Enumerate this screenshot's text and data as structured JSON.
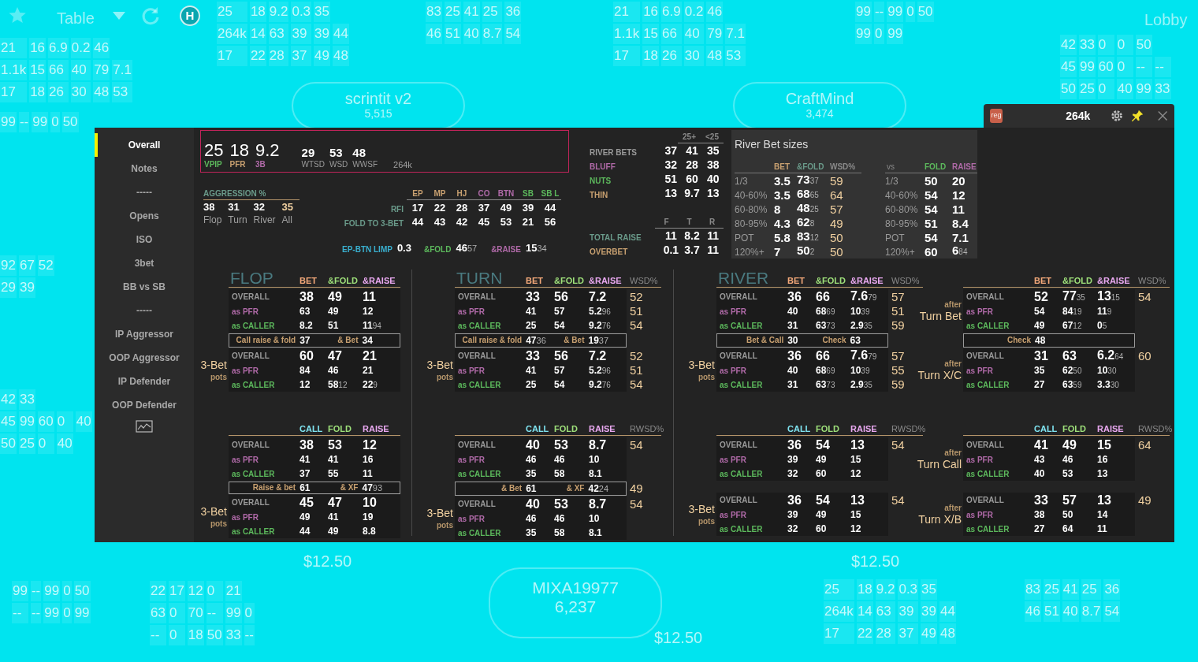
{
  "table": {
    "title": "Table",
    "hotkey": "H",
    "lobby": "Lobby",
    "players": [
      {
        "name": "scrintit v2",
        "stack": "5,515"
      },
      {
        "name": "CraftMind",
        "stack": "3,474"
      },
      {
        "name": "MIXA19977",
        "stack": "6,237"
      }
    ],
    "bets": [
      "$12.50",
      "$12.50",
      "$12.50"
    ],
    "huds": [
      {
        "rows": [
          [
            "21",
            "16",
            "6.9",
            "0.2",
            "46"
          ],
          [
            "1.1k",
            "15",
            "66",
            "40",
            "79",
            "7.1"
          ],
          [
            "17",
            "18",
            "26",
            "30",
            "48",
            "53"
          ]
        ]
      },
      {
        "rows": [
          [
            "25",
            "18",
            "9.2",
            "0.3",
            "35"
          ],
          [
            "264k",
            "14",
            "63",
            "39",
            "39",
            "44"
          ],
          [
            "17",
            "22",
            "28",
            "37",
            "49",
            "48"
          ]
        ]
      },
      {
        "rows": [
          [
            "83",
            "25",
            "41",
            "25",
            "36"
          ],
          [
            "46",
            "51",
            "40",
            "8.7",
            "54"
          ]
        ]
      },
      {
        "rows": [
          [
            "21",
            "16",
            "6.9",
            "0.2",
            "46"
          ],
          [
            "1.1k",
            "15",
            "66",
            "40",
            "79",
            "7.1"
          ],
          [
            "17",
            "18",
            "26",
            "30",
            "48",
            "53"
          ]
        ]
      },
      {
        "rows": [
          [
            "99",
            "--",
            "99",
            "0",
            "50"
          ],
          [
            "99",
            "0",
            "99"
          ]
        ]
      },
      {
        "rows": [
          [
            "42",
            "33",
            "0",
            "0",
            "50"
          ],
          [
            "45",
            "99",
            "60",
            "0",
            "--",
            "--"
          ],
          [
            "50",
            "25",
            "0",
            "40",
            "99",
            "33"
          ]
        ]
      },
      {
        "rows": [
          [
            "99",
            "--",
            "99",
            "0",
            "50"
          ]
        ]
      },
      {
        "rows": [
          [
            "92",
            "67",
            "52"
          ],
          [
            "29",
            "39"
          ]
        ]
      },
      {
        "rows": [
          [
            "42",
            "33"
          ],
          [
            "45",
            "99",
            "60",
            "0",
            "40"
          ],
          [
            "50",
            "25",
            "0",
            "40"
          ]
        ]
      },
      {
        "rows": [
          [
            "99",
            "--",
            "99",
            "0",
            "50"
          ],
          [
            "--",
            "--",
            "99",
            "0",
            "99"
          ]
        ]
      },
      {
        "rows": [
          [
            "22",
            "17",
            "12",
            "0",
            "21"
          ],
          [
            "63",
            "0",
            "70",
            "--",
            "99",
            "0"
          ],
          [
            "--",
            "0",
            "18",
            "50",
            "33",
            "--"
          ]
        ]
      },
      {
        "rows": [
          [
            "25",
            "18",
            "9.2",
            "0.3",
            "35"
          ],
          [
            "264k",
            "14",
            "63",
            "39",
            "39",
            "44"
          ],
          [
            "17",
            "22",
            "28",
            "37",
            "49",
            "48"
          ]
        ]
      },
      {
        "rows": [
          [
            "83",
            "25",
            "41",
            "25",
            "36"
          ],
          [
            "46",
            "51",
            "40",
            "8.7",
            "54"
          ]
        ]
      }
    ]
  },
  "window": {
    "badge": "reg",
    "hands": "264k"
  },
  "sidebar": [
    {
      "label": "Overall",
      "selected": true
    },
    {
      "label": "Notes",
      "selected": false
    },
    {
      "label": "-----",
      "selected": false
    },
    {
      "label": "Opens",
      "selected": false
    },
    {
      "label": "ISO",
      "selected": false
    },
    {
      "label": "3bet",
      "selected": false
    },
    {
      "label": "BB vs SB",
      "selected": false
    },
    {
      "label": "-----",
      "selected": false
    },
    {
      "label": "IP Aggressor",
      "selected": false
    },
    {
      "label": "OOP Aggressor",
      "selected": false
    },
    {
      "label": "IP Defender",
      "selected": false
    },
    {
      "label": "OOP Defender",
      "selected": false
    }
  ],
  "summary": {
    "main": [
      {
        "value": "25",
        "label": "VPIP",
        "color": "#5cb85c"
      },
      {
        "value": "18",
        "label": "PFR",
        "color": "#c8a070"
      },
      {
        "value": "9.2",
        "label": "3B",
        "color": "#b06aa8"
      }
    ],
    "secondary": [
      {
        "value": "29",
        "label": "WTSD"
      },
      {
        "value": "53",
        "label": "WSD"
      },
      {
        "value": "48",
        "label": "WWSF"
      }
    ],
    "hands": "264k"
  },
  "aggression": {
    "title": "AGGRESSION %",
    "items": [
      {
        "value": "38",
        "label": "Flop",
        "kind": "street"
      },
      {
        "value": "31",
        "label": "Turn",
        "kind": "street"
      },
      {
        "value": "32",
        "label": "River",
        "kind": "street"
      },
      {
        "value": "35",
        "label": "All",
        "kind": "total"
      }
    ]
  },
  "positions": {
    "columns": [
      {
        "label": "EP",
        "color": "#c8a070"
      },
      {
        "label": "MP",
        "color": "#c8a070"
      },
      {
        "label": "HJ",
        "color": "#c8a070"
      },
      {
        "label": "CO",
        "color": "#b06aa8"
      },
      {
        "label": "BTN",
        "color": "#b06aa8"
      },
      {
        "label": "SB",
        "color": "#5cb85c"
      },
      {
        "label": "SB L",
        "color": "#5cb85c"
      }
    ],
    "rows": [
      {
        "label": "RFI",
        "values": [
          "17",
          "22",
          "28",
          "37",
          "49",
          "39",
          "44"
        ]
      },
      {
        "label": "FOLD TO 3-BET",
        "values": [
          "44",
          "43",
          "42",
          "45",
          "53",
          "21",
          "56"
        ]
      }
    ]
  },
  "limp": {
    "label": "EP-BTN LIMP",
    "value": "0.3",
    "fold_label": "&FOLD",
    "fold": {
      "v": "46",
      "s": "57"
    },
    "raise_label": "&RAISE",
    "raise": {
      "v": "15",
      "s": "34"
    }
  },
  "river_bets": {
    "columns": [
      "25+",
      "<25"
    ],
    "rows": [
      {
        "label": "RIVER BETS",
        "color": "#9a9a9a",
        "values": [
          "37",
          "41",
          "35"
        ]
      },
      {
        "label": "BLUFF",
        "color": "#b06aa8",
        "values": [
          "32",
          "28",
          "38"
        ]
      },
      {
        "label": "NUTS",
        "color": "#5cb85c",
        "values": [
          "51",
          "60",
          "40"
        ]
      },
      {
        "label": "THIN",
        "color": "#c8a070",
        "values": [
          "13",
          "9.7",
          "13"
        ]
      }
    ]
  },
  "raises": {
    "columns": [
      "F",
      "T",
      "R"
    ],
    "rows": [
      {
        "label": "TOTAL RAISE",
        "color": "#6a9a8a",
        "values": [
          "11",
          "8.2",
          "11"
        ]
      },
      {
        "label": "OVERBET",
        "color": "#c8a070",
        "values": [
          "0.1",
          "3.7",
          "11"
        ]
      }
    ]
  },
  "river_bet_sizes": {
    "title": "River Bet sizes",
    "left": {
      "columns": [
        {
          "label": "BET",
          "color": "#c8a070"
        },
        {
          "label": "&FOLD",
          "color": "#6a9a8a"
        },
        {
          "label": "WSD%",
          "color": "#8a8a8a"
        }
      ],
      "rows": [
        {
          "label": "1/3",
          "values": [
            "3.5",
            {
              "v": "73",
              "s": "37"
            },
            "59"
          ]
        },
        {
          "label": "40-60%",
          "values": [
            "3.5",
            {
              "v": "68",
              "s": "65"
            },
            "64"
          ]
        },
        {
          "label": "60-80%",
          "values": [
            "8",
            {
              "v": "48",
              "s": "25"
            },
            "57"
          ]
        },
        {
          "label": "80-95%",
          "values": [
            "4.3",
            {
              "v": "62",
              "s": "8"
            },
            "49"
          ]
        },
        {
          "label": "POT",
          "values": [
            "5.8",
            {
              "v": "83",
              "s": "12"
            },
            "50"
          ]
        },
        {
          "label": "120%+",
          "values": [
            "7",
            {
              "v": "50",
              "s": "2"
            },
            "50"
          ]
        }
      ]
    },
    "right": {
      "corner": "vs",
      "columns": [
        {
          "label": "FOLD",
          "color": "#5cb85c"
        },
        {
          "label": "RAISE",
          "color": "#b06aa8"
        }
      ],
      "rows": [
        {
          "label": "1/3",
          "values": [
            "50",
            "20"
          ]
        },
        {
          "label": "40-60%",
          "values": [
            "54",
            "12"
          ]
        },
        {
          "label": "60-80%",
          "values": [
            "54",
            "11"
          ]
        },
        {
          "label": "80-95%",
          "values": [
            "51",
            "8.4"
          ]
        },
        {
          "label": "POT",
          "values": [
            "54",
            "7.1"
          ]
        },
        {
          "label": "120%+",
          "values": [
            "60",
            {
              "v": "6",
              "s": "84"
            }
          ]
        }
      ]
    }
  },
  "streets": [
    {
      "title": "FLOP",
      "blocks": [
        {
          "columns": [
            {
              "label": "BET",
              "color": "#f4a97a"
            },
            {
              "label": "&FOLD",
              "color": "#9ee07a"
            },
            {
              "label": "&RAISE",
              "color": "#e9a8f0"
            }
          ],
          "groups": [
            {
              "rows": [
                {
                  "label": "OVERALL",
                  "kind": "overall",
                  "values": [
                    "38",
                    "49",
                    "11"
                  ]
                },
                {
                  "label": "as PFR",
                  "kind": "pfr",
                  "values": [
                    "63",
                    "49",
                    "12"
                  ]
                },
                {
                  "label": "as CALLER",
                  "kind": "caller",
                  "values": [
                    "8.2",
                    "51",
                    {
                      "v": "11",
                      "s": "94"
                    }
                  ]
                }
              ]
            },
            {
              "label": [
                {
                  "text": "3-Bet",
                  "kind": "big"
                },
                {
                  "text": "pots",
                  "kind": "small"
                }
              ],
              "rows": [
                {
                  "label": "OVERALL",
                  "kind": "overall",
                  "values": [
                    "60",
                    "47",
                    "21"
                  ]
                },
                {
                  "label": "as PFR",
                  "kind": "pfr",
                  "values": [
                    "84",
                    "46",
                    "21"
                  ]
                },
                {
                  "label": "as CALLER",
                  "kind": "caller",
                  "values": [
                    "12",
                    {
                      "v": "58",
                      "s": "12"
                    },
                    {
                      "v": "22",
                      "s": "9"
                    }
                  ]
                }
              ]
            }
          ],
          "summary": {
            "items": [
              {
                "label": "Call raise & fold",
                "value": "37"
              },
              {
                "label": "& Bet",
                "value": "34"
              }
            ]
          }
        },
        {
          "columns": [
            {
              "label": "CALL",
              "color": "#7fe3f0"
            },
            {
              "label": "FOLD",
              "color": "#9ee07a"
            },
            {
              "label": "RAISE",
              "color": "#e9a8f0"
            }
          ],
          "groups": [
            {
              "rows": [
                {
                  "label": "OVERALL",
                  "kind": "overall",
                  "values": [
                    "38",
                    "53",
                    "12"
                  ]
                },
                {
                  "label": "as PFR",
                  "kind": "pfr",
                  "values": [
                    "41",
                    "41",
                    "16"
                  ]
                },
                {
                  "label": "as CALLER",
                  "kind": "caller",
                  "values": [
                    "37",
                    "55",
                    "11"
                  ]
                }
              ]
            },
            {
              "label": [
                {
                  "text": "3-Bet",
                  "kind": "big"
                },
                {
                  "text": "pots",
                  "kind": "small"
                }
              ],
              "rows": [
                {
                  "label": "OVERALL",
                  "kind": "overall",
                  "values": [
                    "45",
                    "47",
                    "10"
                  ]
                },
                {
                  "label": "as PFR",
                  "kind": "pfr",
                  "values": [
                    "49",
                    "41",
                    "19"
                  ]
                },
                {
                  "label": "as CALLER",
                  "kind": "caller",
                  "values": [
                    "44",
                    "49",
                    "8.8"
                  ]
                }
              ]
            }
          ],
          "summary": {
            "items": [
              {
                "label": "Raise & bet",
                "value": "61"
              },
              {
                "label": "& XF",
                "value": {
                  "v": "47",
                  "s": "93"
                }
              }
            ]
          }
        }
      ]
    },
    {
      "title": "TURN",
      "blocks": [
        {
          "columns": [
            {
              "label": "BET",
              "color": "#f4a97a"
            },
            {
              "label": "&FOLD",
              "color": "#9ee07a"
            },
            {
              "label": "&RAISE",
              "color": "#e9a8f0"
            }
          ],
          "wsd_label": "WSD%",
          "groups": [
            {
              "rows": [
                {
                  "label": "OVERALL",
                  "kind": "overall",
                  "values": [
                    "33",
                    "56",
                    "7.2"
                  ],
                  "wsd": "52"
                },
                {
                  "label": "as PFR",
                  "kind": "pfr",
                  "values": [
                    "41",
                    "57",
                    {
                      "v": "5.2",
                      "s": "96"
                    }
                  ],
                  "wsd": "51"
                },
                {
                  "label": "as CALLER",
                  "kind": "caller",
                  "values": [
                    "25",
                    "54",
                    {
                      "v": "9.2",
                      "s": "76"
                    }
                  ],
                  "wsd": "54"
                }
              ]
            },
            {
              "label": [
                {
                  "text": "3-Bet",
                  "kind": "big"
                },
                {
                  "text": "pots",
                  "kind": "small"
                }
              ],
              "rows": [
                {
                  "label": "OVERALL",
                  "kind": "overall",
                  "values": [
                    "33",
                    "56",
                    "7.2"
                  ],
                  "wsd": "52"
                },
                {
                  "label": "as PFR",
                  "kind": "pfr",
                  "values": [
                    "41",
                    "57",
                    {
                      "v": "5.2",
                      "s": "96"
                    }
                  ],
                  "wsd": "51"
                },
                {
                  "label": "as CALLER",
                  "kind": "caller",
                  "values": [
                    "25",
                    "54",
                    {
                      "v": "9.2",
                      "s": "76"
                    }
                  ],
                  "wsd": "54"
                }
              ]
            }
          ],
          "summary": {
            "items": [
              {
                "label": "Call raise & fold",
                "value": {
                  "v": "47",
                  "s": "36"
                }
              },
              {
                "label": "& Bet",
                "value": {
                  "v": "19",
                  "s": "37"
                }
              }
            ]
          }
        },
        {
          "columns": [
            {
              "label": "CALL",
              "color": "#7fe3f0"
            },
            {
              "label": "FOLD",
              "color": "#9ee07a"
            },
            {
              "label": "RAISE",
              "color": "#e9a8f0"
            }
          ],
          "wsd_label": "RWSD%",
          "groups": [
            {
              "rows": [
                {
                  "label": "OVERALL",
                  "kind": "overall",
                  "values": [
                    "40",
                    "53",
                    "8.7"
                  ],
                  "wsd": "54"
                },
                {
                  "label": "as PFR",
                  "kind": "pfr",
                  "values": [
                    "46",
                    "46",
                    "10"
                  ]
                },
                {
                  "label": "as CALLER",
                  "kind": "caller",
                  "values": [
                    "35",
                    "58",
                    "8.1"
                  ]
                }
              ]
            },
            {
              "label": [
                {
                  "text": "3-Bet",
                  "kind": "big"
                },
                {
                  "text": "pots",
                  "kind": "small"
                }
              ],
              "rows": [
                {
                  "label": "OVERALL",
                  "kind": "overall",
                  "values": [
                    "40",
                    "53",
                    "8.7"
                  ],
                  "wsd": "54"
                },
                {
                  "label": "as PFR",
                  "kind": "pfr",
                  "values": [
                    "46",
                    "46",
                    "10"
                  ]
                },
                {
                  "label": "as CALLER",
                  "kind": "caller",
                  "values": [
                    "35",
                    "58",
                    "8.1"
                  ]
                }
              ]
            }
          ],
          "summary": {
            "items": [
              {
                "label": "& Bet",
                "value": "61"
              },
              {
                "label": "& XF",
                "value": {
                  "v": "42",
                  "s": "24"
                }
              }
            ],
            "wsd": "49"
          }
        }
      ]
    },
    {
      "title": "RIVER",
      "blocks": [
        {
          "columns": [
            {
              "label": "BET",
              "color": "#f4a97a"
            },
            {
              "label": "&FOLD",
              "color": "#9ee07a"
            },
            {
              "label": "&RAISE",
              "color": "#e9a8f0"
            }
          ],
          "wsd_label": "WSD%",
          "groups": [
            {
              "rows": [
                {
                  "label": "OVERALL",
                  "kind": "overall",
                  "values": [
                    "36",
                    "66",
                    {
                      "v": "7.6",
                      "s": "79"
                    }
                  ],
                  "wsd": "57"
                },
                {
                  "label": "as PFR",
                  "kind": "pfr",
                  "values": [
                    "40",
                    {
                      "v": "68",
                      "s": "69"
                    },
                    {
                      "v": "10",
                      "s": "39"
                    }
                  ],
                  "wsd": "51"
                },
                {
                  "label": "as CALLER",
                  "kind": "caller",
                  "values": [
                    "31",
                    {
                      "v": "63",
                      "s": "73"
                    },
                    {
                      "v": "2.9",
                      "s": "35"
                    }
                  ],
                  "wsd": "59"
                }
              ]
            },
            {
              "label": [
                {
                  "text": "3-Bet",
                  "kind": "big"
                },
                {
                  "text": "pots",
                  "kind": "small"
                }
              ],
              "rows": [
                {
                  "label": "OVERALL",
                  "kind": "overall",
                  "values": [
                    "36",
                    "66",
                    {
                      "v": "7.6",
                      "s": "79"
                    }
                  ],
                  "wsd": "57"
                },
                {
                  "label": "as PFR",
                  "kind": "pfr",
                  "values": [
                    "40",
                    {
                      "v": "68",
                      "s": "69"
                    },
                    {
                      "v": "10",
                      "s": "39"
                    }
                  ],
                  "wsd": "55"
                },
                {
                  "label": "as CALLER",
                  "kind": "caller",
                  "values": [
                    "31",
                    {
                      "v": "63",
                      "s": "73"
                    },
                    {
                      "v": "2.9",
                      "s": "35"
                    }
                  ],
                  "wsd": "59"
                }
              ]
            }
          ],
          "summary": {
            "items": [
              {
                "label": "Bet & Call",
                "value": "30"
              },
              {
                "label": "Check",
                "value": "63"
              }
            ]
          }
        },
        {
          "columns": [
            {
              "label": "CALL",
              "color": "#7fe3f0"
            },
            {
              "label": "FOLD",
              "color": "#9ee07a"
            },
            {
              "label": "RAISE",
              "color": "#e9a8f0"
            }
          ],
          "wsd_label": "RWSD%",
          "groups": [
            {
              "rows": [
                {
                  "label": "OVERALL",
                  "kind": "overall",
                  "values": [
                    "36",
                    "54",
                    "13"
                  ],
                  "wsd": "54"
                },
                {
                  "label": "as PFR",
                  "kind": "pfr",
                  "values": [
                    "39",
                    "49",
                    "15"
                  ]
                },
                {
                  "label": "as CALLER",
                  "kind": "caller",
                  "values": [
                    "32",
                    "60",
                    "12"
                  ]
                }
              ]
            },
            {
              "label": [
                {
                  "text": "3-Bet",
                  "kind": "big"
                },
                {
                  "text": "pots",
                  "kind": "small"
                }
              ],
              "rows": [
                {
                  "label": "OVERALL",
                  "kind": "overall",
                  "values": [
                    "36",
                    "54",
                    "13"
                  ],
                  "wsd": "54"
                },
                {
                  "label": "as PFR",
                  "kind": "pfr",
                  "values": [
                    "39",
                    "49",
                    "15"
                  ]
                },
                {
                  "label": "as CALLER",
                  "kind": "caller",
                  "values": [
                    "32",
                    "60",
                    "12"
                  ]
                }
              ]
            }
          ]
        }
      ]
    },
    {
      "blocks": [
        {
          "columns": [
            {
              "label": "BET",
              "color": "#f4a97a"
            },
            {
              "label": "&FOLD",
              "color": "#9ee07a"
            },
            {
              "label": "&RAISE",
              "color": "#e9a8f0"
            }
          ],
          "wsd_label": "WSD%",
          "groups": [
            {
              "label": [
                {
                  "text": "after",
                  "kind": "small"
                },
                {
                  "text": "Turn Bet",
                  "kind": "big"
                }
              ],
              "rows": [
                {
                  "label": "OVERALL",
                  "kind": "overall",
                  "values": [
                    "52",
                    {
                      "v": "77",
                      "s": "35"
                    },
                    {
                      "v": "13",
                      "s": "15"
                    }
                  ],
                  "wsd": "54"
                },
                {
                  "label": "as PFR",
                  "kind": "pfr",
                  "values": [
                    "54",
                    {
                      "v": "84",
                      "s": "19"
                    },
                    {
                      "v": "11",
                      "s": "9"
                    }
                  ]
                },
                {
                  "label": "as CALLER",
                  "kind": "caller",
                  "values": [
                    "49",
                    {
                      "v": "67",
                      "s": "12"
                    },
                    {
                      "v": "0",
                      "s": "5"
                    }
                  ]
                }
              ]
            },
            {
              "label": [
                {
                  "text": "after",
                  "kind": "small"
                },
                {
                  "text": "Turn X/C",
                  "kind": "big"
                }
              ],
              "rows": [
                {
                  "label": "OVERALL",
                  "kind": "overall",
                  "values": [
                    "31",
                    "63",
                    {
                      "v": "6.2",
                      "s": "64"
                    }
                  ],
                  "wsd": "60"
                },
                {
                  "label": "as PFR",
                  "kind": "pfr",
                  "values": [
                    "35",
                    {
                      "v": "62",
                      "s": "50"
                    },
                    {
                      "v": "10",
                      "s": "30"
                    }
                  ]
                },
                {
                  "label": "as CALLER",
                  "kind": "caller",
                  "values": [
                    "27",
                    {
                      "v": "63",
                      "s": "59"
                    },
                    {
                      "v": "3.3",
                      "s": "30"
                    }
                  ]
                }
              ]
            }
          ],
          "summary": {
            "items": [
              {
                "label": "Check",
                "value": "48"
              }
            ]
          }
        },
        {
          "columns": [
            {
              "label": "CALL",
              "color": "#7fe3f0"
            },
            {
              "label": "FOLD",
              "color": "#9ee07a"
            },
            {
              "label": "RAISE",
              "color": "#e9a8f0"
            }
          ],
          "wsd_label": "RWSD%",
          "groups": [
            {
              "label": [
                {
                  "text": "after",
                  "kind": "small"
                },
                {
                  "text": "Turn Call",
                  "kind": "big"
                }
              ],
              "rows": [
                {
                  "label": "OVERALL",
                  "kind": "overall",
                  "values": [
                    "41",
                    "49",
                    "15"
                  ],
                  "wsd": "64"
                },
                {
                  "label": "as PFR",
                  "kind": "pfr",
                  "values": [
                    "43",
                    "46",
                    "16"
                  ]
                },
                {
                  "label": "as CALLER",
                  "kind": "caller",
                  "values": [
                    "40",
                    "53",
                    "13"
                  ]
                }
              ]
            },
            {
              "label": [
                {
                  "text": "after",
                  "kind": "small"
                },
                {
                  "text": "Turn X/B",
                  "kind": "big"
                }
              ],
              "rows": [
                {
                  "label": "OVERALL",
                  "kind": "overall",
                  "values": [
                    "33",
                    "57",
                    "13"
                  ],
                  "wsd": "49"
                },
                {
                  "label": "as PFR",
                  "kind": "pfr",
                  "values": [
                    "38",
                    "50",
                    "14"
                  ]
                },
                {
                  "label": "as CALLER",
                  "kind": "caller",
                  "values": [
                    "27",
                    "64",
                    "11"
                  ]
                }
              ]
            }
          ]
        }
      ]
    }
  ]
}
